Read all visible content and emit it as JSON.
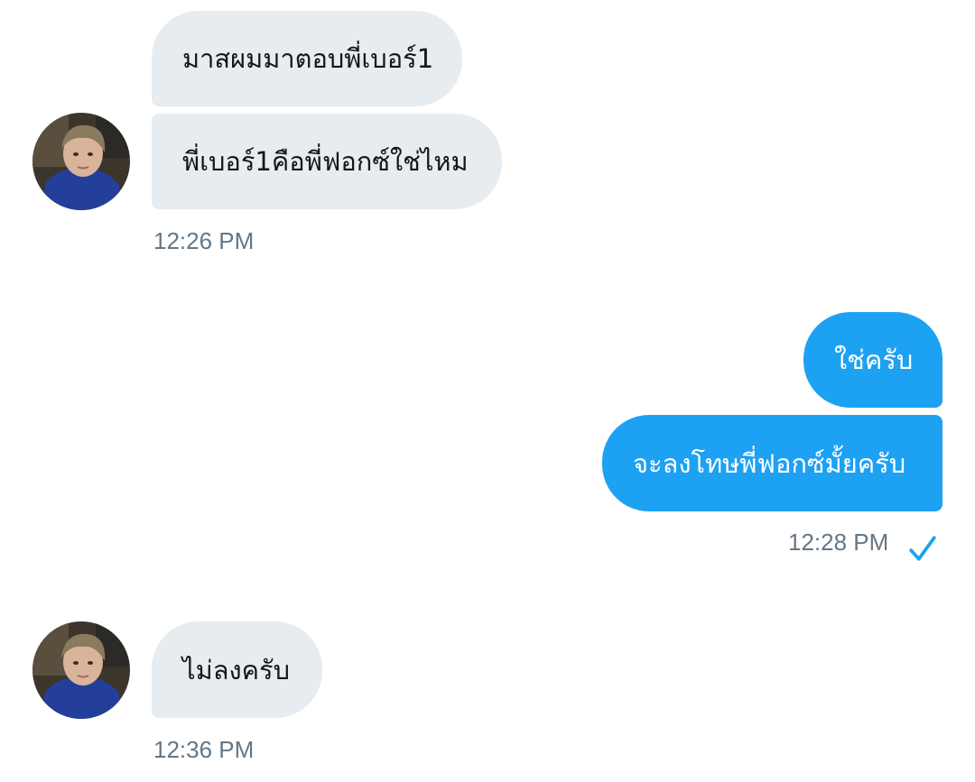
{
  "conversation": {
    "groups": [
      {
        "direction": "incoming",
        "messages": [
          "มาสผมมาตอบพี่เบอร์1",
          "พี่เบอร์1คือพี่ฟอกซ์ใช่ไหม"
        ],
        "time": "12:26 PM",
        "avatar_icon": "user-avatar"
      },
      {
        "direction": "outgoing",
        "messages": [
          "ใช่ครับ",
          "จะลงโทษพี่ฟอกซ์มั้ยครับ"
        ],
        "time": "12:28 PM",
        "status_icon": "checkmark-icon"
      },
      {
        "direction": "incoming",
        "messages": [
          "ไม่ลงครับ"
        ],
        "time": "12:36 PM",
        "avatar_icon": "user-avatar"
      }
    ]
  },
  "colors": {
    "incoming_bubble": "#e6ecf0",
    "outgoing_bubble": "#1da1f2",
    "incoming_text": "#14171a",
    "outgoing_text": "#ffffff",
    "timestamp": "#657786",
    "check": "#1da1f2"
  }
}
